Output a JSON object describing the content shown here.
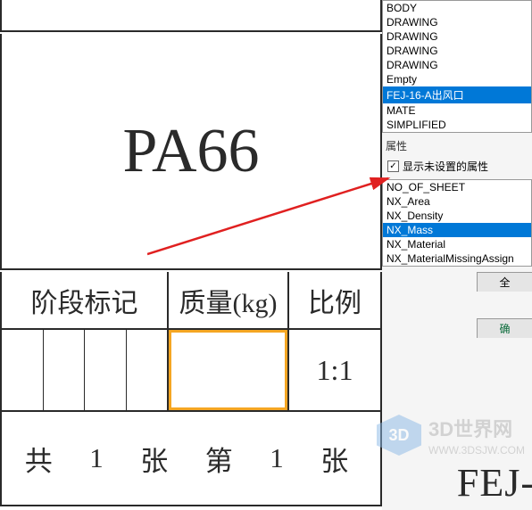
{
  "drawing": {
    "main_text": "PA66",
    "headers": {
      "phase": "阶段标记",
      "mass": "质量(kg)",
      "ratio": "比例"
    },
    "ratio_value": "1:1",
    "sheet_total_label": "共",
    "sheet_total_num": "1",
    "sheet_unit1": "张",
    "sheet_current_label": "第",
    "sheet_current_num": "1",
    "sheet_unit2": "张",
    "corner_text": "FEJ-"
  },
  "panel": {
    "list1": [
      "BODY",
      "DRAWING",
      "DRAWING",
      "DRAWING",
      "DRAWING",
      "Empty",
      "FEJ-16-A出风口",
      "MATE",
      "SIMPLIFIED"
    ],
    "list1_selected": 6,
    "section_label": "属性",
    "checkbox_checked": true,
    "checkbox_label": "显示未设置的属性",
    "list2": [
      "NO_OF_SHEET",
      "NX_Area",
      "NX_Density",
      "NX_Mass",
      "NX_Material",
      "NX_MaterialMissingAssign"
    ],
    "list2_selected": 3,
    "btn_all": "全",
    "btn_ok": "确"
  },
  "watermark": {
    "icon": "3D",
    "cn": "3D世界网",
    "en": "WWW.3DSJW.COM"
  }
}
